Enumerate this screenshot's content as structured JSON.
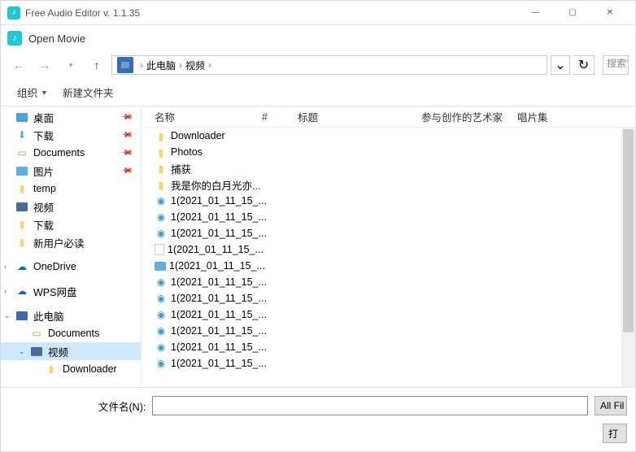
{
  "app": {
    "title": "Free Audio Editor v. 1.1.35"
  },
  "dialog": {
    "title": "Open Movie"
  },
  "breadcrumb": {
    "seg1": "此电脑",
    "seg2": "视频"
  },
  "search": {
    "placeholder": "搜索\"视"
  },
  "toolbar": {
    "organize": "组织",
    "newfolder": "新建文件夹"
  },
  "sidebar": {
    "desktop": "桌面",
    "downloads": "下载",
    "documents": "Documents",
    "pictures": "图片",
    "temp": "temp",
    "videos": "视频",
    "downloads2": "下载",
    "newuser": "新用户必读",
    "onedrive": "OneDrive",
    "wps": "WPS网盘",
    "thispc": "此电脑",
    "pc_documents": "Documents",
    "pc_videos": "视频",
    "pc_downloader": "Downloader"
  },
  "columns": {
    "name": "名称",
    "num": "#",
    "title": "标题",
    "artist": "参与创作的艺术家",
    "album": "唱片集"
  },
  "files": [
    {
      "name": "Downloader",
      "type": "folder"
    },
    {
      "name": "Photos",
      "type": "folder"
    },
    {
      "name": "捕获",
      "type": "folder"
    },
    {
      "name": "我是你的白月光亦...",
      "type": "folder"
    },
    {
      "name": "1(2021_01_11_15_...",
      "type": "media"
    },
    {
      "name": "1(2021_01_11_15_...",
      "type": "media"
    },
    {
      "name": "1(2021_01_11_15_...",
      "type": "media"
    },
    {
      "name": "1(2021_01_11_15_...",
      "type": "generic"
    },
    {
      "name": "1(2021_01_11_15_...",
      "type": "img"
    },
    {
      "name": "1(2021_01_11_15_...",
      "type": "media"
    },
    {
      "name": "1(2021_01_11_15_...",
      "type": "media"
    },
    {
      "name": "1(2021_01_11_15_...",
      "type": "media"
    },
    {
      "name": "1(2021_01_11_15_...",
      "type": "media"
    },
    {
      "name": "1(2021_01_11_15_...",
      "type": "media"
    },
    {
      "name": "1(2021_01_11_15_...",
      "type": "media"
    }
  ],
  "footer": {
    "filename_label": "文件名(N):",
    "allfiles": "All Fil",
    "open": "打"
  }
}
